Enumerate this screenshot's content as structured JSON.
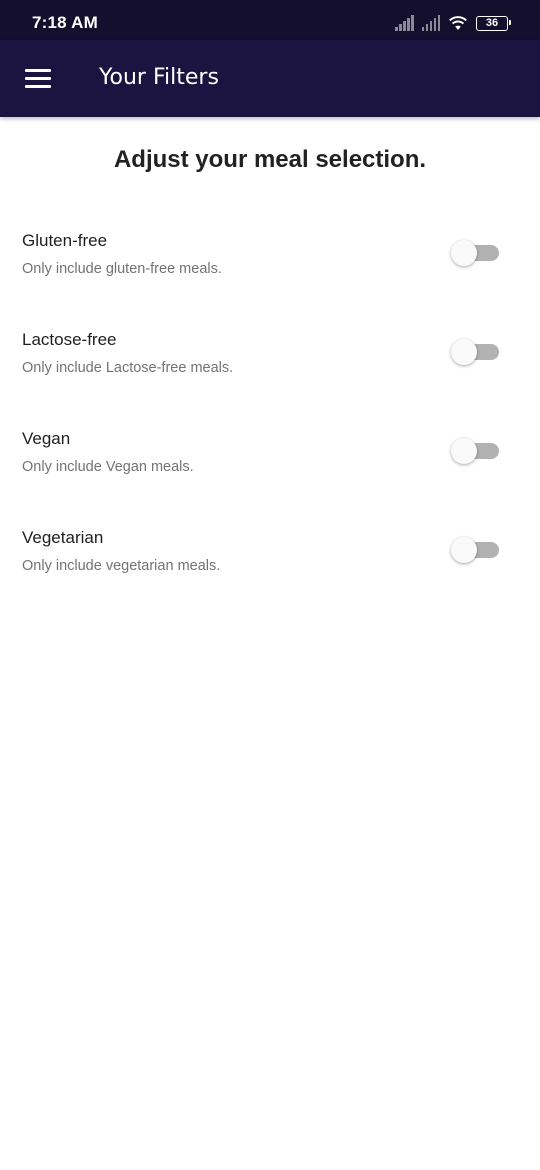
{
  "status_bar": {
    "time": "7:18 AM",
    "battery": "36",
    "icons": [
      "signal-icon",
      "signal-icon",
      "wifi-icon",
      "battery-icon"
    ]
  },
  "app_bar": {
    "title": "Your Filters",
    "menu_icon": "hamburger-menu-icon",
    "background": "#1c1440"
  },
  "heading": "Adjust your meal selection.",
  "filters": [
    {
      "title": "Gluten-free",
      "subtitle": "Only include gluten-free meals.",
      "enabled": false
    },
    {
      "title": "Lactose-free",
      "subtitle": "Only include Lactose-free meals.",
      "enabled": false
    },
    {
      "title": "Vegan",
      "subtitle": "Only include Vegan meals.",
      "enabled": false
    },
    {
      "title": "Vegetarian",
      "subtitle": "Only include vegetarian meals.",
      "enabled": false
    }
  ]
}
